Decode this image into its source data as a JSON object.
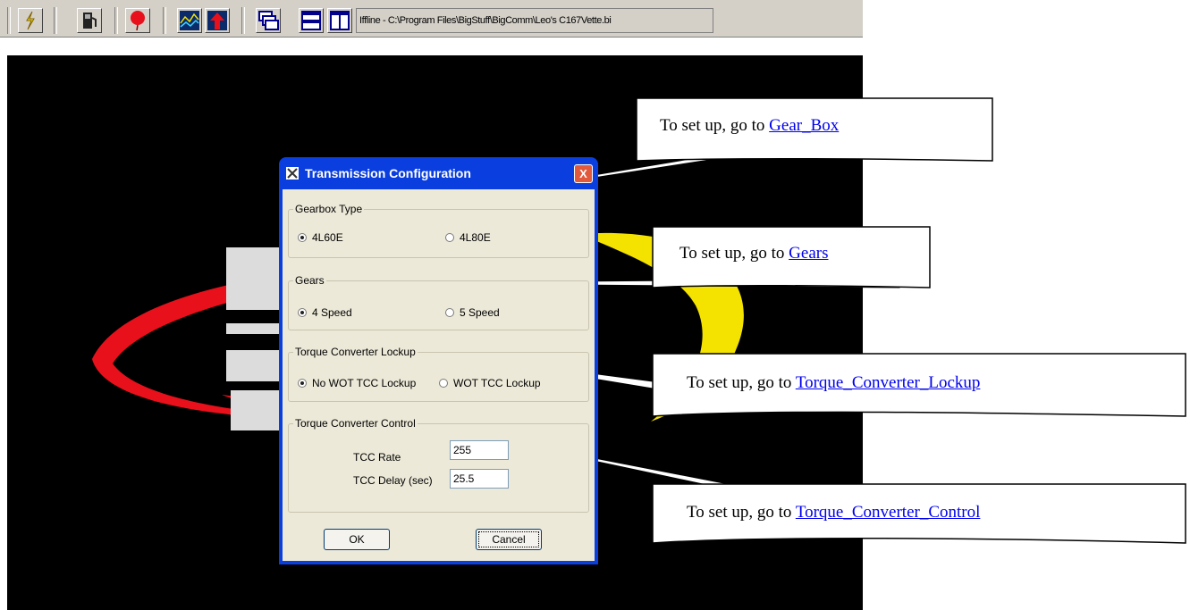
{
  "toolbar": {
    "path_text": "Iffline - C:\\Program Files\\BigStuff\\BigComm\\Leo's C167Vette.bi",
    "buttons": [
      "connect-icon",
      "fuel-pump-icon",
      "balloon-icon",
      "graph-icon",
      "upload-icon",
      "stacked-windows-icon",
      "horizontal-split-icon",
      "vertical-split-icon"
    ]
  },
  "dialog": {
    "title": "Transmission Configuration",
    "close_label": "X",
    "gearbox": {
      "legend": "Gearbox Type",
      "options": [
        "4L60E",
        "4L80E"
      ],
      "selected": "4L60E"
    },
    "gears": {
      "legend": "Gears",
      "options": [
        "4 Speed",
        "5 Speed"
      ],
      "selected": "4 Speed"
    },
    "lockup": {
      "legend": "Torque Converter Lockup",
      "options": [
        "No WOT TCC Lockup",
        "WOT TCC Lockup"
      ],
      "selected": "No WOT TCC Lockup"
    },
    "control": {
      "legend": "Torque Converter Control",
      "tcc_rate_label": "TCC Rate",
      "tcc_rate_value": "255",
      "tcc_delay_label": "TCC Delay (sec)",
      "tcc_delay_value": "25.5"
    },
    "ok_label": "OK",
    "cancel_label": "Cancel"
  },
  "callouts": [
    {
      "prefix": "To set up, go to ",
      "link": "Gear_Box"
    },
    {
      "prefix": "To set up, go to ",
      "link": "Gears"
    },
    {
      "prefix": "To set up, go to ",
      "link": "Torque_Converter_Lockup"
    },
    {
      "prefix": "To set up, go to ",
      "link": "Torque_Converter_Control"
    }
  ],
  "colors": {
    "title_bar": "#0a3ede",
    "dialog_face": "#ece9d8",
    "logo_red": "#e8101a",
    "logo_yellow": "#f4e200",
    "link": "#0000ee"
  }
}
